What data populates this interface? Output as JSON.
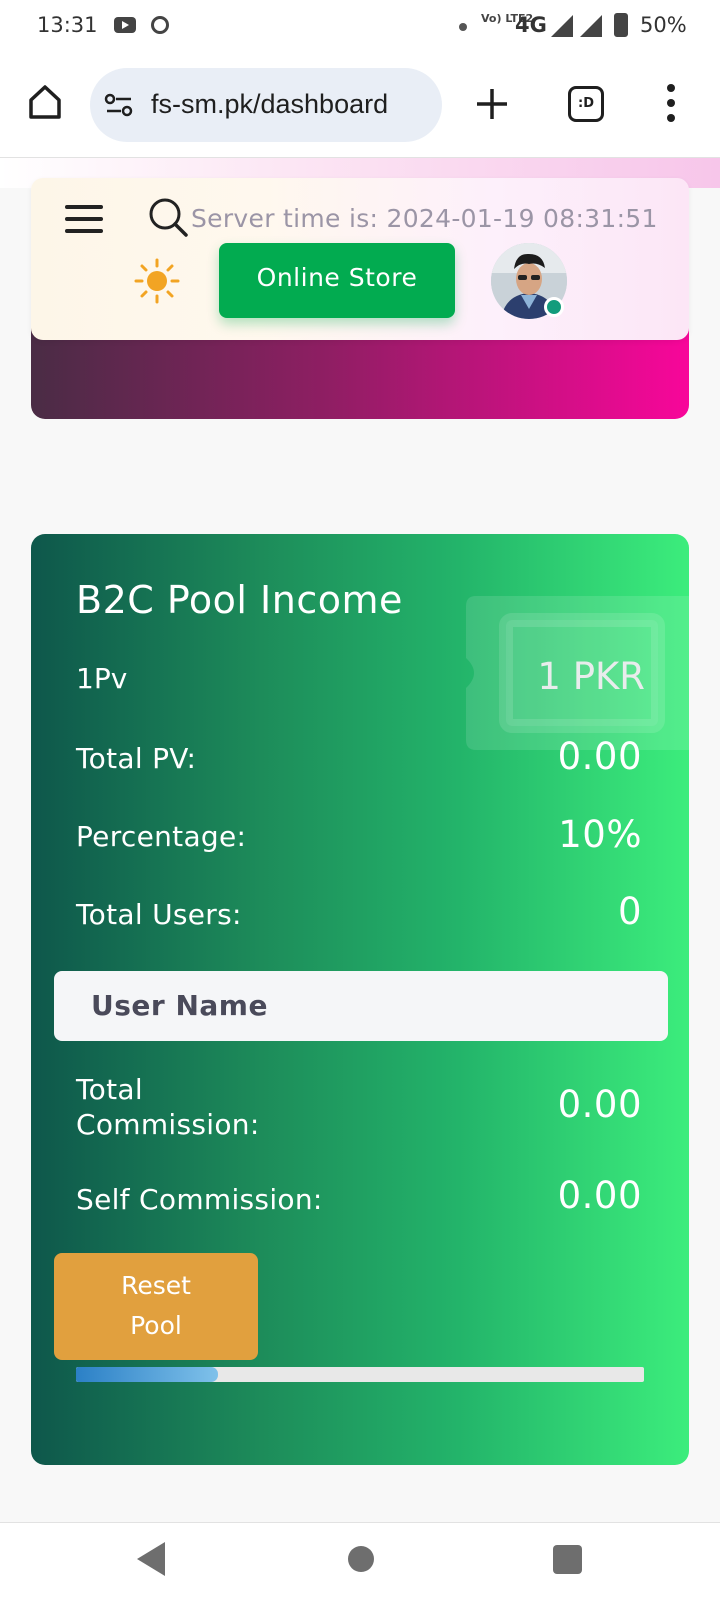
{
  "status_bar": {
    "time": "13:31",
    "network": "4G",
    "volte": "Vo) LTE2",
    "battery": "50%"
  },
  "browser": {
    "url": "fs-sm.pk/dashboard",
    "tabs_label": ":D"
  },
  "header": {
    "server_time": "Server time is: 2024-01-19 08:31:51",
    "online_store_label": "Online Store"
  },
  "pool_card": {
    "title": "B2C Pool Income",
    "pv_label": "1Pv",
    "pv_value": "1 PKR",
    "rows": [
      {
        "label": "Total PV:",
        "value": "0.00"
      },
      {
        "label": "Percentage:",
        "value": "10%"
      },
      {
        "label": "Total Users:",
        "value": "0"
      }
    ],
    "user_name_placeholder": "User Name",
    "commission_rows": [
      {
        "label_line1": "Total",
        "label_line2": "Commission:",
        "value": "0.00"
      },
      {
        "label": "Self Commission:",
        "value": "0.00"
      }
    ],
    "reset_line1": "Reset",
    "reset_line2": "Pool",
    "progress_fraction": 0.25
  },
  "colors": {
    "store_button": "#02ab50",
    "reset_button": "#e1a03e",
    "card_gradient_start": "#0e574b",
    "card_gradient_end": "#3ced7c",
    "hero_gradient_end": "#f8069a"
  }
}
